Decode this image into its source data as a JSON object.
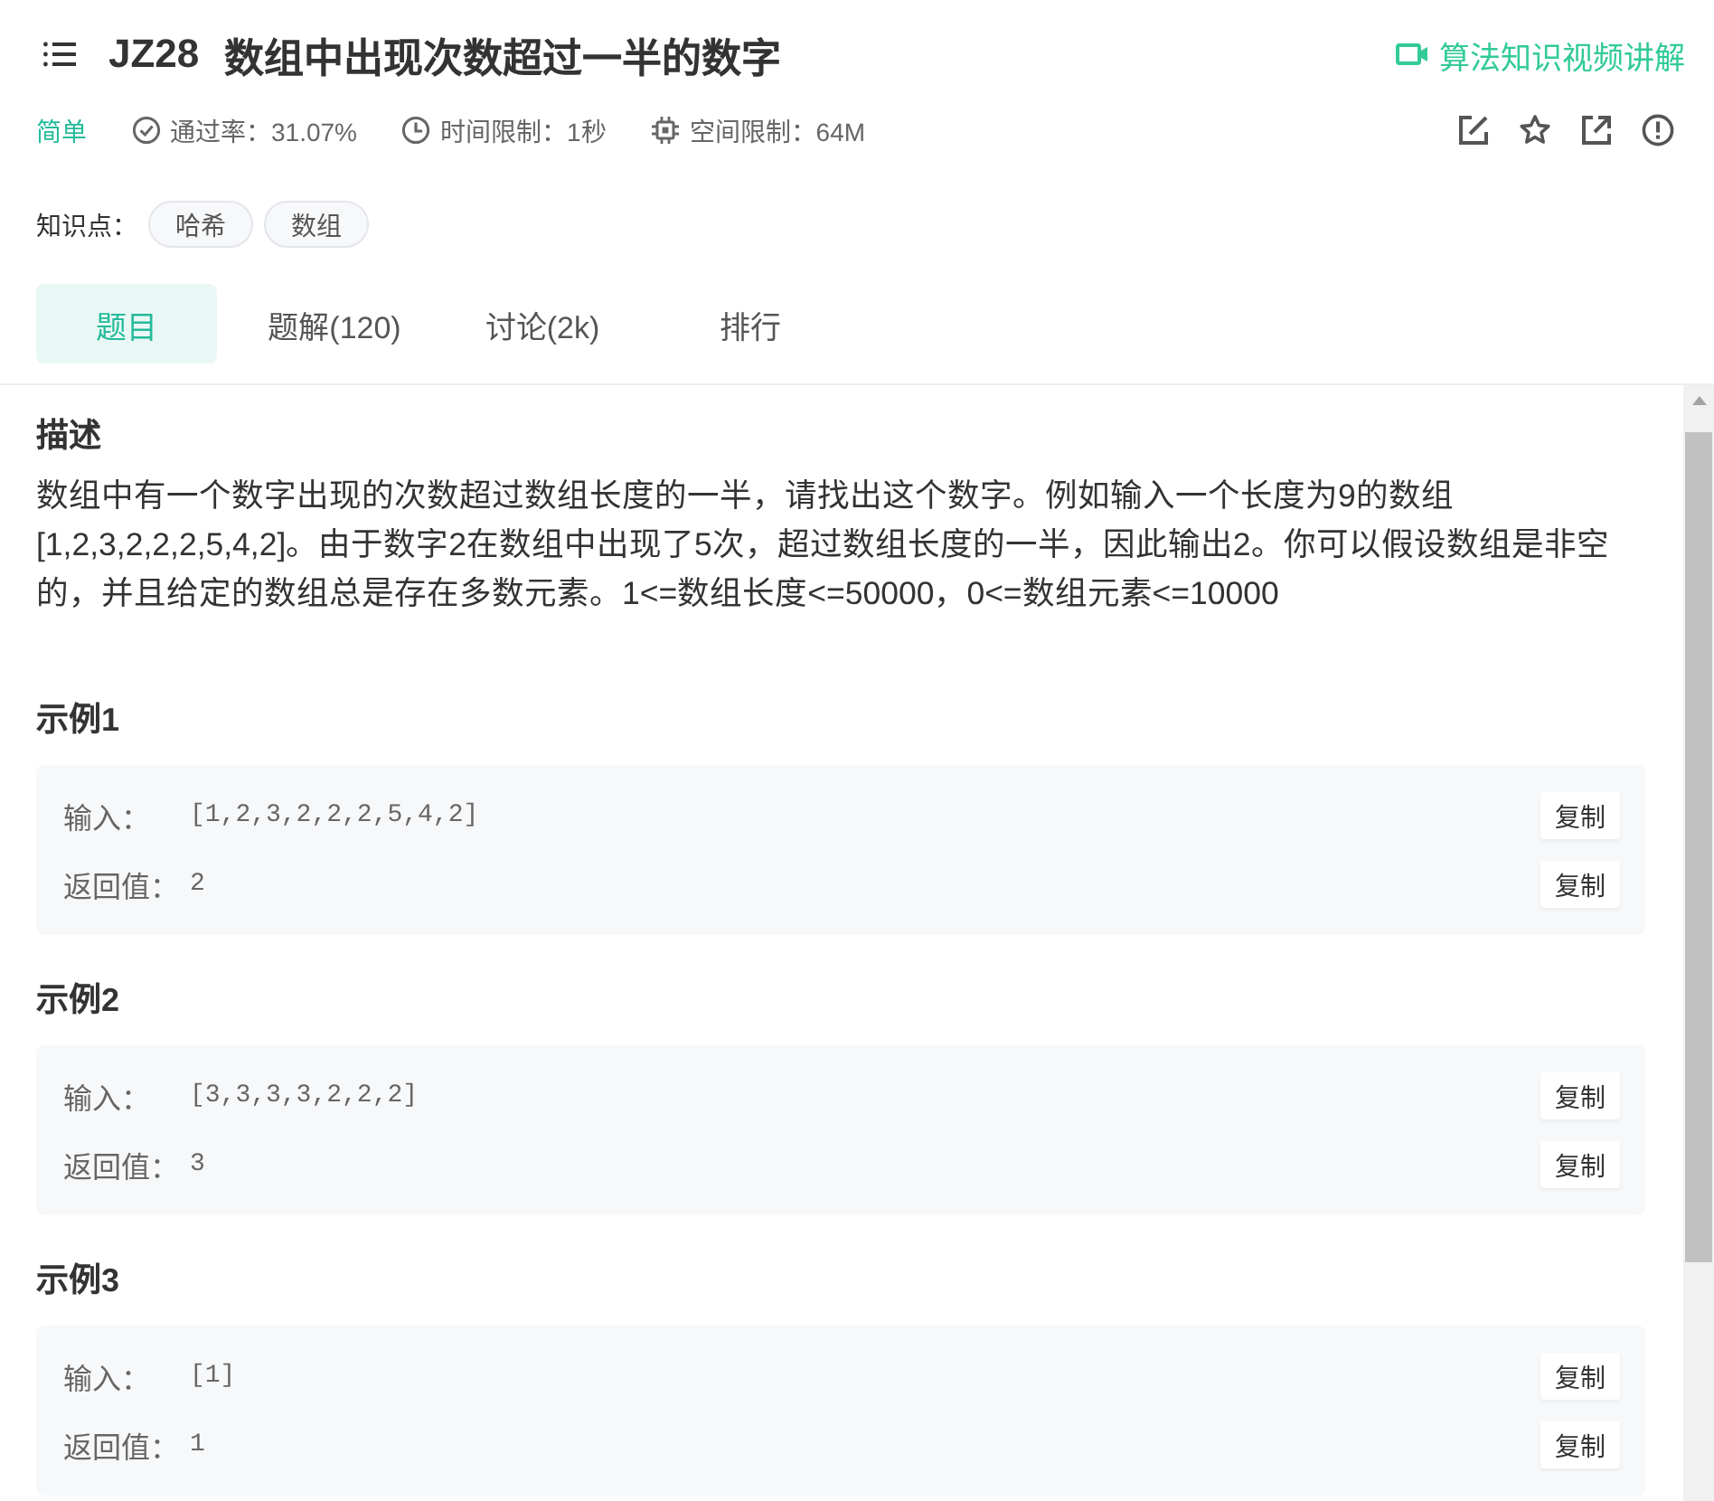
{
  "problem": {
    "id": "JZ28",
    "title": "数组中出现次数超过一半的数字"
  },
  "video_link": "算法知识视频讲解",
  "meta": {
    "difficulty": "简单",
    "items": [
      {
        "kind": "check",
        "text": "通过率：31.07%"
      },
      {
        "kind": "clock",
        "text": "时间限制：1秒"
      },
      {
        "kind": "chip",
        "text": "空间限制：64M"
      }
    ]
  },
  "tags": {
    "label": "知识点：",
    "items": [
      "哈希",
      "数组"
    ]
  },
  "tabs": [
    {
      "label": "题目",
      "selected": true
    },
    {
      "label": "题解(120)",
      "selected": false
    },
    {
      "label": "讨论(2k)",
      "selected": false
    },
    {
      "label": "排行",
      "selected": false
    }
  ],
  "description": {
    "heading": "描述",
    "text": "数组中有一个数字出现的次数超过数组长度的一半，请找出这个数字。例如输入一个长度为9的数组[1,2,3,2,2,2,5,4,2]。由于数字2在数组中出现了5次，超过数组长度的一半，因此输出2。你可以假设数组是非空的，并且给定的数组总是存在多数元素。1<=数组长度<=50000，0<=数组元素<=10000"
  },
  "examples": [
    {
      "heading": "示例1",
      "rows": [
        {
          "label": "输入：",
          "value": "[1,2,3,2,2,2,5,4,2]",
          "copy": "复制"
        },
        {
          "label": "返回值：",
          "value": "2",
          "copy": "复制"
        }
      ]
    },
    {
      "heading": "示例2",
      "rows": [
        {
          "label": "输入：",
          "value": "[3,3,3,3,2,2,2]",
          "copy": "复制"
        },
        {
          "label": "返回值：",
          "value": "3",
          "copy": "复制"
        }
      ]
    },
    {
      "heading": "示例3",
      "rows": [
        {
          "label": "输入：",
          "value": "[1]",
          "copy": "复制"
        },
        {
          "label": "返回值：",
          "value": "1",
          "copy": "复制"
        }
      ]
    }
  ]
}
